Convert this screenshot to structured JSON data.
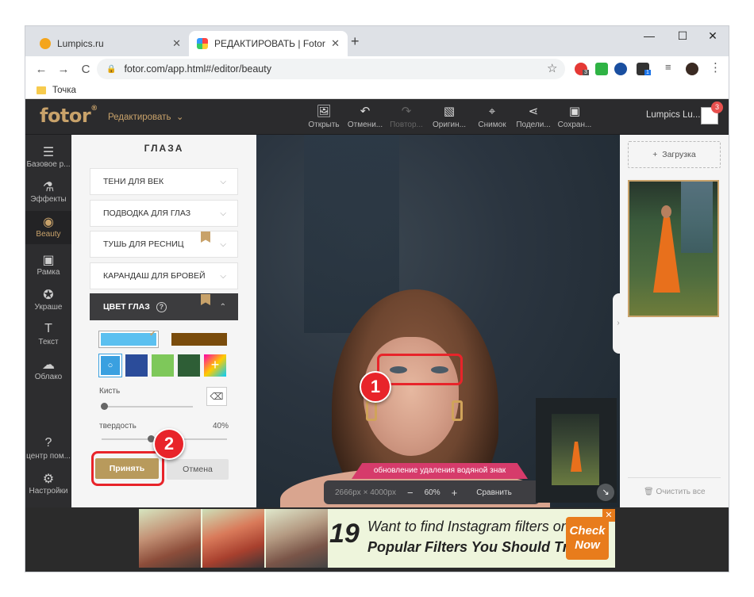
{
  "browser": {
    "tabs": [
      {
        "title": "Lumpics.ru",
        "close": "✕"
      },
      {
        "title": "РЕДАКТИРОВАТЬ | Fotor",
        "close": "✕"
      }
    ],
    "new_tab": "+",
    "window_controls": [
      "—",
      "☐",
      "✕"
    ],
    "nav": {
      "back": "←",
      "forward": "→",
      "reload": "C"
    },
    "url": "fotor.com/app.html#/editor/beauty",
    "ext_badges": [
      "3",
      "1"
    ],
    "bookmarks": [
      {
        "label": "Точка"
      }
    ]
  },
  "app": {
    "logo": "fotor",
    "logo_mark": "®",
    "edit_menu": "Редактировать",
    "toolbar": [
      {
        "label": "Открыть",
        "icon": "open-image-icon",
        "glyph": "🖼",
        "enabled": true
      },
      {
        "label": "Отмени...",
        "icon": "undo-icon",
        "glyph": "↶",
        "enabled": true
      },
      {
        "label": "Повтор...",
        "icon": "redo-icon",
        "glyph": "↷",
        "enabled": false
      },
      {
        "label": "Оригин...",
        "icon": "original-icon",
        "glyph": "▧",
        "enabled": true
      },
      {
        "label": "Снимок",
        "icon": "snapshot-icon",
        "glyph": "⌖",
        "enabled": true
      },
      {
        "label": "Подели...",
        "icon": "share-icon",
        "glyph": "⋖",
        "enabled": true
      },
      {
        "label": "Сохран...",
        "icon": "save-icon",
        "glyph": "▣",
        "enabled": true
      }
    ],
    "user": {
      "name": "Lumpics Lu...",
      "badge": "3"
    },
    "sidebar": [
      {
        "label": "Базовое р...",
        "icon": "sliders-icon",
        "glyph": "☰"
      },
      {
        "label": "Эффекты",
        "icon": "flask-icon",
        "glyph": "⚗"
      },
      {
        "label": "Beauty",
        "icon": "eye-icon",
        "glyph": "◉",
        "active": true
      },
      {
        "label": "Рамка",
        "icon": "frame-icon",
        "glyph": "▣"
      },
      {
        "label": "Украше",
        "icon": "sticker-icon",
        "glyph": "✪"
      },
      {
        "label": "Текст",
        "icon": "text-icon",
        "glyph": "T"
      },
      {
        "label": "Облако",
        "icon": "cloud-icon",
        "glyph": "☁"
      }
    ],
    "sidebar_bottom": [
      {
        "label": "центр пом...",
        "icon": "help-icon",
        "glyph": "?"
      },
      {
        "label": "Настройки",
        "icon": "settings-icon",
        "glyph": "⚙"
      }
    ],
    "panel": {
      "title": "ГЛАЗА",
      "sections": [
        {
          "label": "ТЕНИ ДЛЯ ВЕК"
        },
        {
          "label": "ПОДВОДКА ДЛЯ ГЛАЗ"
        },
        {
          "label": "ТУШЬ ДЛЯ РЕСНИЦ",
          "premium": true
        },
        {
          "label": "КАРАНДАШ ДЛЯ БРОВЕЙ"
        },
        {
          "label": "ЦВЕТ ГЛАЗ",
          "premium": true,
          "expanded": true,
          "help": "?"
        }
      ],
      "colors": {
        "selected": "#5bc0f0",
        "second": "#7a4c0c",
        "swatches": [
          "#3aa0e0",
          "#2b4c9a",
          "#7ec85a",
          "#2e5e36",
          "gradient"
        ]
      },
      "brush": {
        "label": "Кисть",
        "value": 0.02
      },
      "hardness": {
        "label": "твердость",
        "value": "40%"
      },
      "apply_label": "Принять",
      "cancel_label": "Отмена"
    },
    "canvas": {
      "watermark_banner": "обновление удаления водяной знак",
      "dimensions": "2666px × 4000px",
      "zoom_minus": "−",
      "zoom": "60%",
      "zoom_plus": "+",
      "compare": "Сравнить",
      "markers": [
        "1",
        "2"
      ]
    },
    "right_panel": {
      "upload_label": "Загрузка",
      "clear_label": "Очистить все"
    },
    "ad": {
      "number": "19",
      "line1": "Want to find Instagram filters online?",
      "line2": "Popular Filters You Should Try",
      "cta": "Check Now",
      "close": "✕"
    }
  }
}
